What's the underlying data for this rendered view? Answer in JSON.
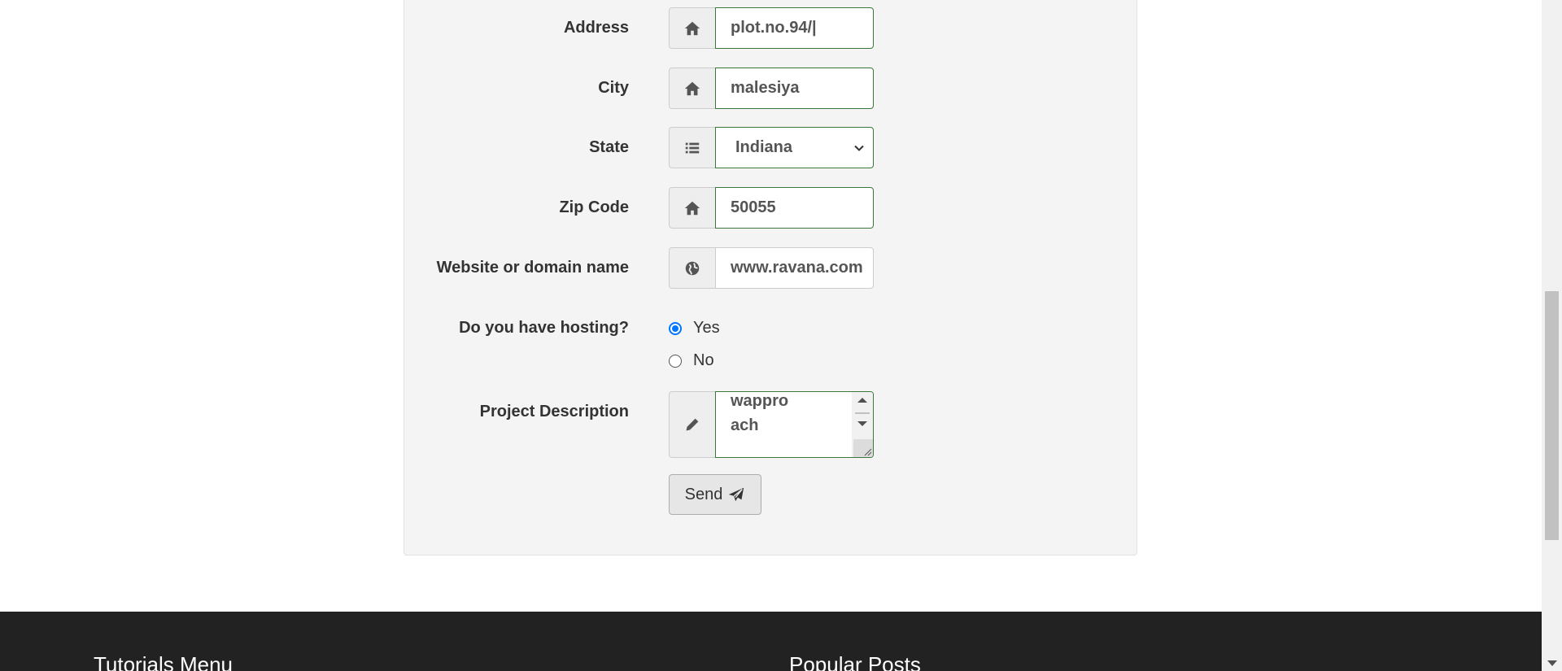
{
  "form": {
    "address": {
      "label": "Address",
      "value": "plot.no.94/|",
      "icon": "home-icon"
    },
    "city": {
      "label": "City",
      "value": "malesiya",
      "icon": "home-icon"
    },
    "state": {
      "label": "State",
      "value": "Indiana",
      "icon": "list-icon"
    },
    "zip": {
      "label": "Zip Code",
      "value": "50055",
      "icon": "home-icon"
    },
    "website": {
      "label": "Website or domain name",
      "value": "www.ravana.com",
      "icon": "globe-icon"
    },
    "hosting": {
      "label": "Do you have hosting?",
      "options": [
        {
          "label": "Yes",
          "checked": true
        },
        {
          "label": "No",
          "checked": false
        }
      ]
    },
    "description": {
      "label": "Project Description",
      "value": "wappro\nach",
      "icon": "pencil-icon"
    },
    "send_label": "Send",
    "send_icon": "paper-plane-icon"
  },
  "footer": {
    "tutorials_heading": "Tutorials Menu",
    "posts_heading": "Popular Posts"
  },
  "colors": {
    "panel_bg": "#f4f4f4",
    "valid_border": "#3c763d",
    "radio_accent": "#0075ff",
    "footer_bg": "#222222"
  }
}
